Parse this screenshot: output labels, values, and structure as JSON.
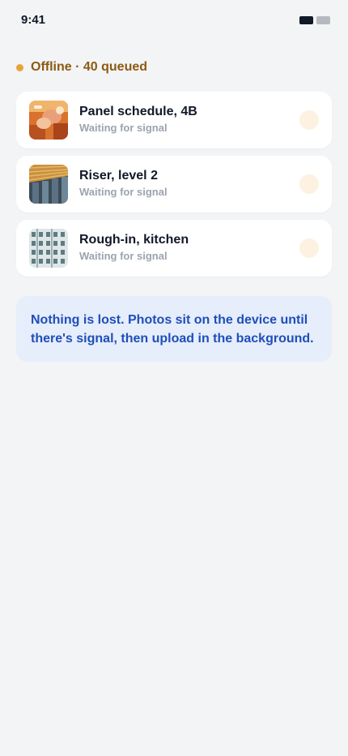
{
  "status_bar": {
    "time": "9:41"
  },
  "offline_banner": {
    "text": "Offline · 40 queued",
    "dot_color": "#e9a23b"
  },
  "queue": [
    {
      "title": "Panel schedule, 4B",
      "status": "Waiting for signal",
      "thumbnail": "panel-photo"
    },
    {
      "title": "Riser, level 2",
      "status": "Waiting for signal",
      "thumbnail": "riser-photo"
    },
    {
      "title": "Rough-in, kitchen",
      "status": "Waiting for signal",
      "thumbnail": "facade-photo"
    }
  ],
  "info_note": {
    "text": "Nothing is lost. Photos sit on the device until there's signal, then upload in the background."
  }
}
